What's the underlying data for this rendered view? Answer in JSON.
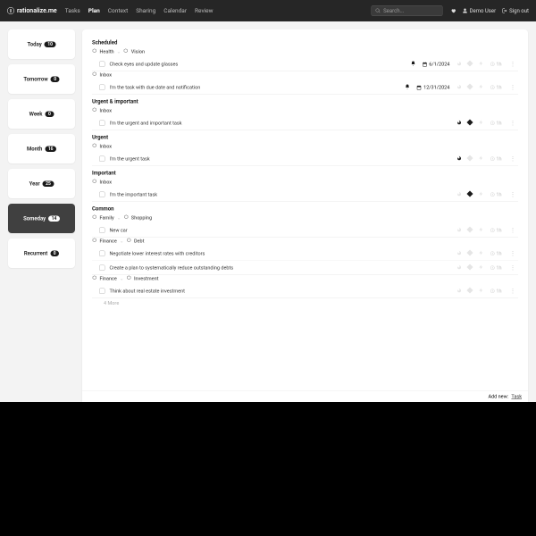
{
  "brand": "rationalize.me",
  "nav": {
    "tasks": "Tasks",
    "plan": "Plan",
    "context": "Context",
    "sharing": "Sharing",
    "calendar": "Calendar",
    "review": "Review"
  },
  "search": {
    "placeholder": "Search..."
  },
  "topbar": {
    "user": "Demo User",
    "signout": "Sign out"
  },
  "sidebar": [
    {
      "label": "Today",
      "count": "10"
    },
    {
      "label": "Tomorrow",
      "count": "0"
    },
    {
      "label": "Week",
      "count": "0"
    },
    {
      "label": "Month",
      "count": "16"
    },
    {
      "label": "Year",
      "count": "25"
    },
    {
      "label": "Someday",
      "count": "14"
    },
    {
      "label": "Recurrent",
      "count": "0"
    }
  ],
  "sections": [
    {
      "title": "Scheduled",
      "groups": [
        {
          "crumbs": [
            "Health",
            "Vision"
          ],
          "tasks": [
            {
              "name": "Check eyes and update glasses",
              "bell": true,
              "date": "6/1/2024",
              "fire": false,
              "diamond": false,
              "bolt": false,
              "hours": "1h"
            }
          ]
        },
        {
          "crumbs": [
            "Inbox"
          ],
          "tasks": [
            {
              "name": "I'm the task with due date and notification",
              "bell": true,
              "date": "12/31/2024",
              "fire": false,
              "diamond": false,
              "bolt": false,
              "hours": "1h"
            }
          ]
        }
      ]
    },
    {
      "title": "Urgent & important",
      "groups": [
        {
          "crumbs": [
            "Inbox"
          ],
          "tasks": [
            {
              "name": "I'm the urgent and important task",
              "bell": false,
              "date": "",
              "fire": true,
              "diamond": true,
              "bolt": false,
              "hours": "1h"
            }
          ]
        }
      ]
    },
    {
      "title": "Urgent",
      "groups": [
        {
          "crumbs": [
            "Inbox"
          ],
          "tasks": [
            {
              "name": "I'm the urgent task",
              "bell": false,
              "date": "",
              "fire": true,
              "diamond": false,
              "bolt": false,
              "hours": "1h"
            }
          ]
        }
      ]
    },
    {
      "title": "Important",
      "groups": [
        {
          "crumbs": [
            "Inbox"
          ],
          "tasks": [
            {
              "name": "I'm the important task",
              "bell": false,
              "date": "",
              "fire": false,
              "diamond": true,
              "bolt": false,
              "hours": "1h"
            }
          ]
        }
      ]
    },
    {
      "title": "Common",
      "groups": [
        {
          "crumbs": [
            "Family",
            "Shopping"
          ],
          "tasks": [
            {
              "name": "New car",
              "bell": false,
              "date": "",
              "fire": false,
              "diamond": false,
              "bolt": false,
              "hours": "1h"
            }
          ]
        },
        {
          "crumbs": [
            "Finance",
            "Debt"
          ],
          "tasks": [
            {
              "name": "Negotiate lower interest rates with creditors",
              "bell": false,
              "date": "",
              "fire": false,
              "diamond": false,
              "bolt": false,
              "hours": "1h"
            },
            {
              "name": "Create a plan to systematically reduce outstanding debts",
              "bell": false,
              "date": "",
              "fire": false,
              "diamond": false,
              "bolt": false,
              "hours": "1h"
            }
          ]
        },
        {
          "crumbs": [
            "Finance",
            "Investment"
          ],
          "tasks": [
            {
              "name": "Think about real estate investment",
              "bell": false,
              "date": "",
              "fire": false,
              "diamond": false,
              "bolt": false,
              "hours": "1h"
            }
          ],
          "moreText": "4 More"
        }
      ]
    }
  ],
  "addnew": {
    "label": "Add new:",
    "task": "Task"
  }
}
